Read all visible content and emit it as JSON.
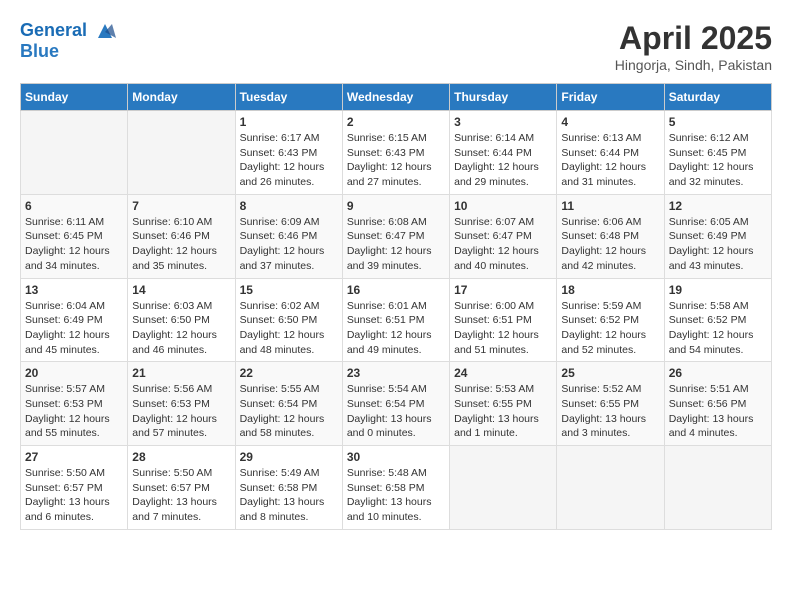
{
  "header": {
    "logo_line1": "General",
    "logo_line2": "Blue",
    "month": "April 2025",
    "location": "Hingorja, Sindh, Pakistan"
  },
  "weekdays": [
    "Sunday",
    "Monday",
    "Tuesday",
    "Wednesday",
    "Thursday",
    "Friday",
    "Saturday"
  ],
  "weeks": [
    [
      {
        "num": "",
        "empty": true
      },
      {
        "num": "",
        "empty": true
      },
      {
        "num": "1",
        "sunrise": "Sunrise: 6:17 AM",
        "sunset": "Sunset: 6:43 PM",
        "daylight": "Daylight: 12 hours and 26 minutes."
      },
      {
        "num": "2",
        "sunrise": "Sunrise: 6:15 AM",
        "sunset": "Sunset: 6:43 PM",
        "daylight": "Daylight: 12 hours and 27 minutes."
      },
      {
        "num": "3",
        "sunrise": "Sunrise: 6:14 AM",
        "sunset": "Sunset: 6:44 PM",
        "daylight": "Daylight: 12 hours and 29 minutes."
      },
      {
        "num": "4",
        "sunrise": "Sunrise: 6:13 AM",
        "sunset": "Sunset: 6:44 PM",
        "daylight": "Daylight: 12 hours and 31 minutes."
      },
      {
        "num": "5",
        "sunrise": "Sunrise: 6:12 AM",
        "sunset": "Sunset: 6:45 PM",
        "daylight": "Daylight: 12 hours and 32 minutes."
      }
    ],
    [
      {
        "num": "6",
        "sunrise": "Sunrise: 6:11 AM",
        "sunset": "Sunset: 6:45 PM",
        "daylight": "Daylight: 12 hours and 34 minutes."
      },
      {
        "num": "7",
        "sunrise": "Sunrise: 6:10 AM",
        "sunset": "Sunset: 6:46 PM",
        "daylight": "Daylight: 12 hours and 35 minutes."
      },
      {
        "num": "8",
        "sunrise": "Sunrise: 6:09 AM",
        "sunset": "Sunset: 6:46 PM",
        "daylight": "Daylight: 12 hours and 37 minutes."
      },
      {
        "num": "9",
        "sunrise": "Sunrise: 6:08 AM",
        "sunset": "Sunset: 6:47 PM",
        "daylight": "Daylight: 12 hours and 39 minutes."
      },
      {
        "num": "10",
        "sunrise": "Sunrise: 6:07 AM",
        "sunset": "Sunset: 6:47 PM",
        "daylight": "Daylight: 12 hours and 40 minutes."
      },
      {
        "num": "11",
        "sunrise": "Sunrise: 6:06 AM",
        "sunset": "Sunset: 6:48 PM",
        "daylight": "Daylight: 12 hours and 42 minutes."
      },
      {
        "num": "12",
        "sunrise": "Sunrise: 6:05 AM",
        "sunset": "Sunset: 6:49 PM",
        "daylight": "Daylight: 12 hours and 43 minutes."
      }
    ],
    [
      {
        "num": "13",
        "sunrise": "Sunrise: 6:04 AM",
        "sunset": "Sunset: 6:49 PM",
        "daylight": "Daylight: 12 hours and 45 minutes."
      },
      {
        "num": "14",
        "sunrise": "Sunrise: 6:03 AM",
        "sunset": "Sunset: 6:50 PM",
        "daylight": "Daylight: 12 hours and 46 minutes."
      },
      {
        "num": "15",
        "sunrise": "Sunrise: 6:02 AM",
        "sunset": "Sunset: 6:50 PM",
        "daylight": "Daylight: 12 hours and 48 minutes."
      },
      {
        "num": "16",
        "sunrise": "Sunrise: 6:01 AM",
        "sunset": "Sunset: 6:51 PM",
        "daylight": "Daylight: 12 hours and 49 minutes."
      },
      {
        "num": "17",
        "sunrise": "Sunrise: 6:00 AM",
        "sunset": "Sunset: 6:51 PM",
        "daylight": "Daylight: 12 hours and 51 minutes."
      },
      {
        "num": "18",
        "sunrise": "Sunrise: 5:59 AM",
        "sunset": "Sunset: 6:52 PM",
        "daylight": "Daylight: 12 hours and 52 minutes."
      },
      {
        "num": "19",
        "sunrise": "Sunrise: 5:58 AM",
        "sunset": "Sunset: 6:52 PM",
        "daylight": "Daylight: 12 hours and 54 minutes."
      }
    ],
    [
      {
        "num": "20",
        "sunrise": "Sunrise: 5:57 AM",
        "sunset": "Sunset: 6:53 PM",
        "daylight": "Daylight: 12 hours and 55 minutes."
      },
      {
        "num": "21",
        "sunrise": "Sunrise: 5:56 AM",
        "sunset": "Sunset: 6:53 PM",
        "daylight": "Daylight: 12 hours and 57 minutes."
      },
      {
        "num": "22",
        "sunrise": "Sunrise: 5:55 AM",
        "sunset": "Sunset: 6:54 PM",
        "daylight": "Daylight: 12 hours and 58 minutes."
      },
      {
        "num": "23",
        "sunrise": "Sunrise: 5:54 AM",
        "sunset": "Sunset: 6:54 PM",
        "daylight": "Daylight: 13 hours and 0 minutes."
      },
      {
        "num": "24",
        "sunrise": "Sunrise: 5:53 AM",
        "sunset": "Sunset: 6:55 PM",
        "daylight": "Daylight: 13 hours and 1 minute."
      },
      {
        "num": "25",
        "sunrise": "Sunrise: 5:52 AM",
        "sunset": "Sunset: 6:55 PM",
        "daylight": "Daylight: 13 hours and 3 minutes."
      },
      {
        "num": "26",
        "sunrise": "Sunrise: 5:51 AM",
        "sunset": "Sunset: 6:56 PM",
        "daylight": "Daylight: 13 hours and 4 minutes."
      }
    ],
    [
      {
        "num": "27",
        "sunrise": "Sunrise: 5:50 AM",
        "sunset": "Sunset: 6:57 PM",
        "daylight": "Daylight: 13 hours and 6 minutes."
      },
      {
        "num": "28",
        "sunrise": "Sunrise: 5:50 AM",
        "sunset": "Sunset: 6:57 PM",
        "daylight": "Daylight: 13 hours and 7 minutes."
      },
      {
        "num": "29",
        "sunrise": "Sunrise: 5:49 AM",
        "sunset": "Sunset: 6:58 PM",
        "daylight": "Daylight: 13 hours and 8 minutes."
      },
      {
        "num": "30",
        "sunrise": "Sunrise: 5:48 AM",
        "sunset": "Sunset: 6:58 PM",
        "daylight": "Daylight: 13 hours and 10 minutes."
      },
      {
        "num": "",
        "empty": true
      },
      {
        "num": "",
        "empty": true
      },
      {
        "num": "",
        "empty": true
      }
    ]
  ]
}
